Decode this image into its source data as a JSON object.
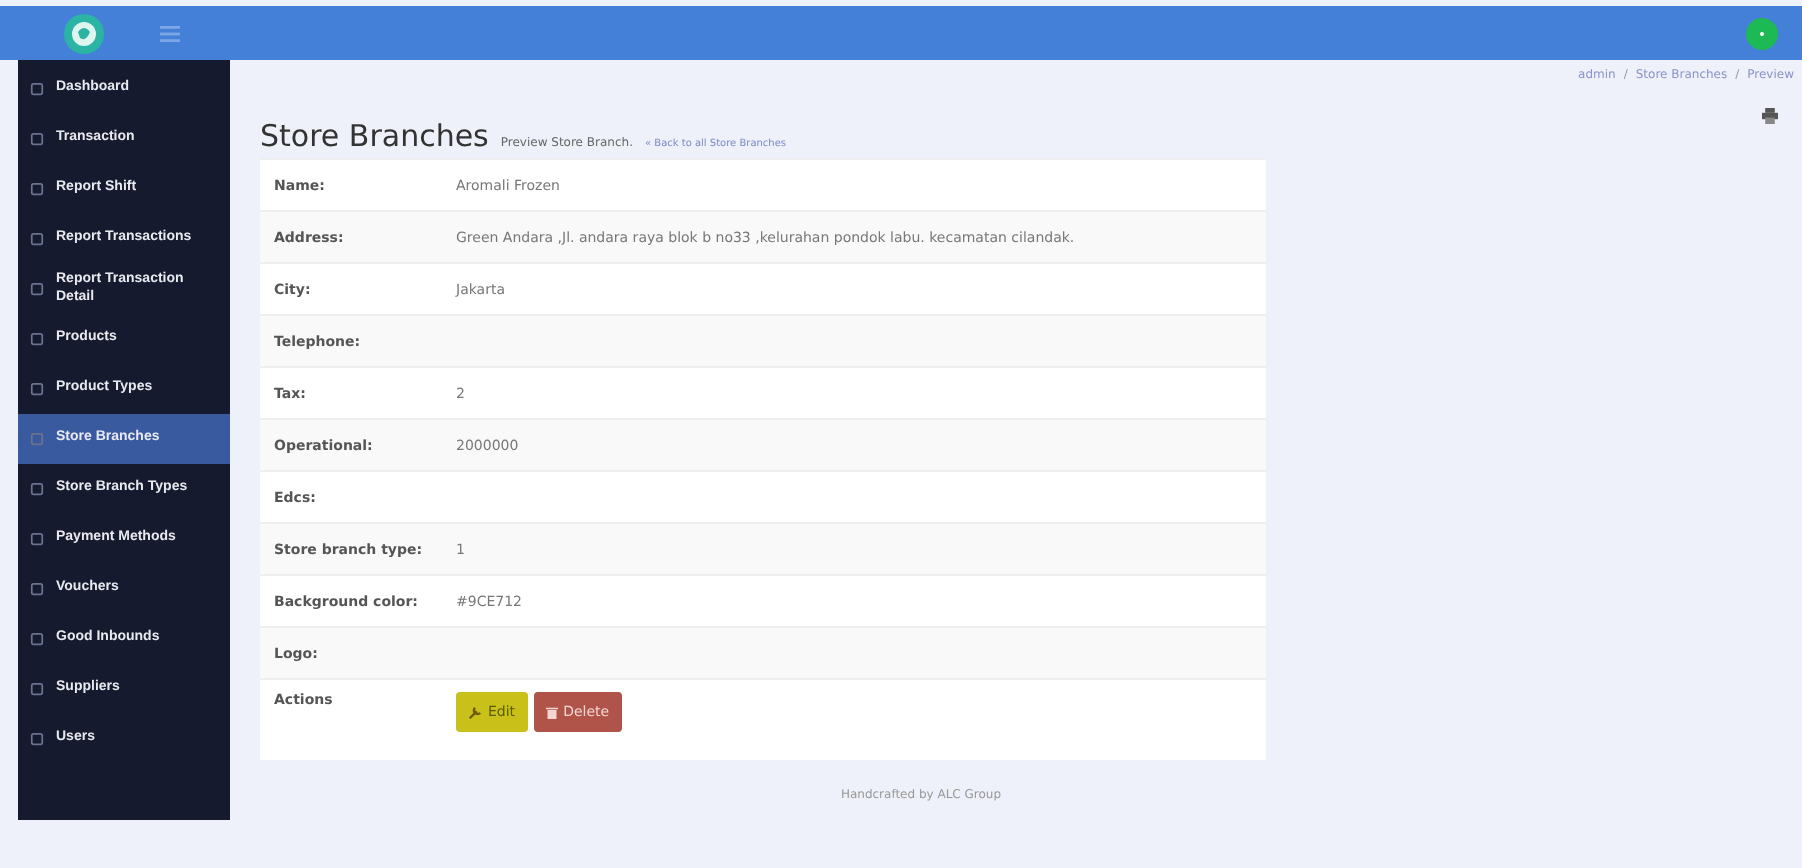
{
  "sidebar": {
    "items": [
      {
        "label": "Dashboard",
        "selected": false
      },
      {
        "label": "Transaction",
        "selected": false
      },
      {
        "label": "Report Shift",
        "selected": false
      },
      {
        "label": "Report Transactions",
        "selected": false
      },
      {
        "label": "Report Transaction Detail",
        "selected": false
      },
      {
        "label": "Products",
        "selected": false
      },
      {
        "label": "Product Types",
        "selected": false
      },
      {
        "label": "Store Branches",
        "selected": true
      },
      {
        "label": "Store Branch Types",
        "selected": false
      },
      {
        "label": "Payment Methods",
        "selected": false
      },
      {
        "label": "Vouchers",
        "selected": false
      },
      {
        "label": "Good Inbounds",
        "selected": false
      },
      {
        "label": "Suppliers",
        "selected": false
      },
      {
        "label": "Users",
        "selected": false
      }
    ]
  },
  "breadcrumb": [
    {
      "label": "admin"
    },
    {
      "separator": "/",
      "label": "Store Branches"
    },
    {
      "separator": "/",
      "label": "Preview"
    }
  ],
  "page": {
    "title": "Store Branches",
    "subtitle": "Preview Store Branch.",
    "back_link": "« Back to all Store Branches"
  },
  "details": [
    {
      "label": "Name:",
      "value": "Aromali Frozen"
    },
    {
      "label": "Address:",
      "value": "Green Andara ,Jl. andara raya blok b no33 ,kelurahan pondok labu. kecamatan cilandak."
    },
    {
      "label": "City:",
      "value": "Jakarta"
    },
    {
      "label": "Telephone:"
    },
    {
      "label": "Tax:",
      "value": "2"
    },
    {
      "label": "Operational:",
      "value": "2000000"
    },
    {
      "label": "Edcs:"
    },
    {
      "label": "Store branch type:",
      "value": "1"
    },
    {
      "label": "Background color:",
      "value": "#9CE712"
    },
    {
      "label": "Logo:"
    }
  ],
  "actions": {
    "label": "Actions",
    "buttons": [
      {
        "label": "Edit",
        "kind": "edit"
      },
      {
        "label": "Delete",
        "kind": "delete"
      }
    ]
  },
  "footer": "Handcrafted by ALC Group"
}
